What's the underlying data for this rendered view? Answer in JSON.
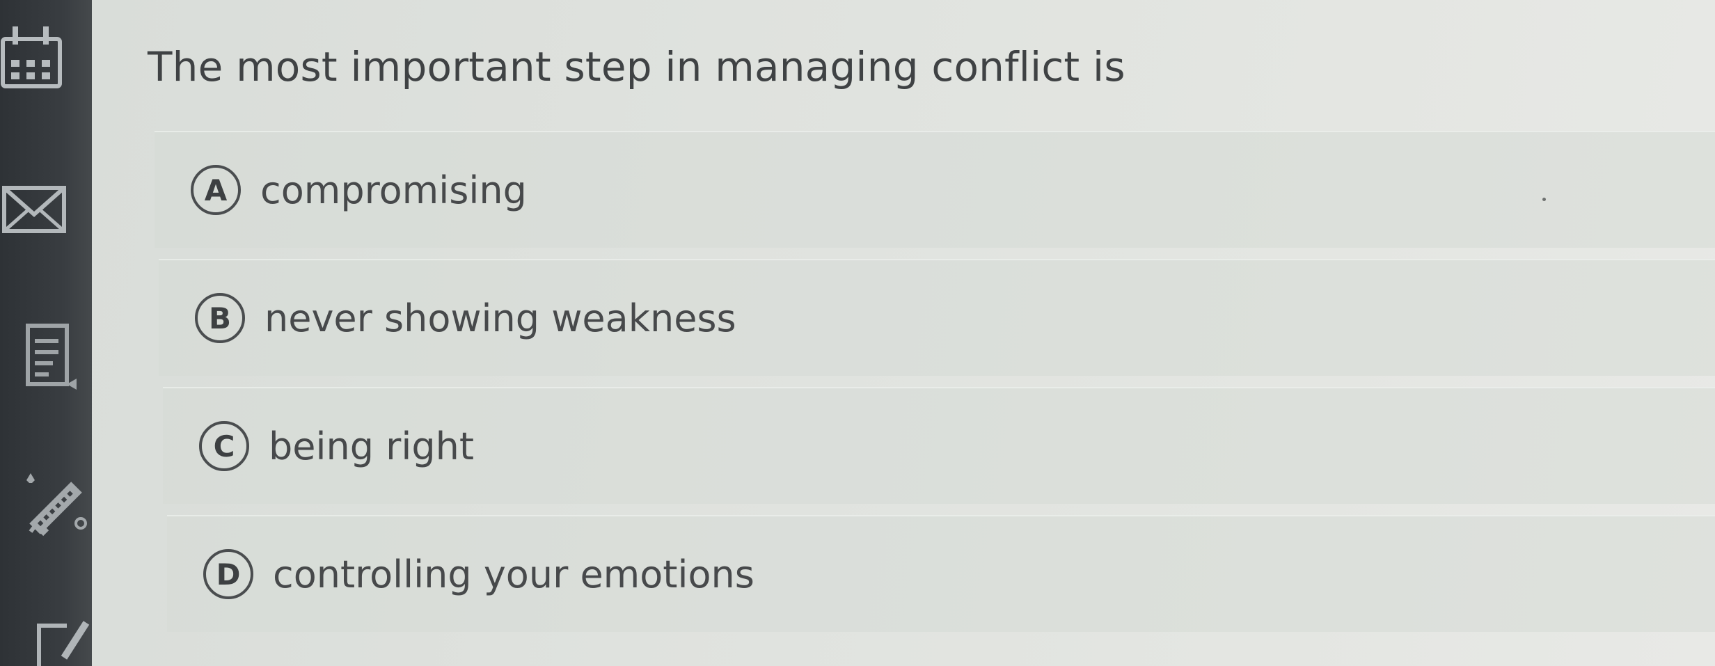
{
  "question": {
    "text": "The most important step in managing conflict is"
  },
  "options": [
    {
      "letter": "A",
      "text": "compromising"
    },
    {
      "letter": "B",
      "text": "never showing weakness"
    },
    {
      "letter": "C",
      "text": "being right"
    },
    {
      "letter": "D",
      "text": "controlling your emotions"
    }
  ],
  "sidebar": {
    "icons": [
      "calendar-icon",
      "mail-icon",
      "notes-icon",
      "pencil-icon",
      "edit-icon"
    ]
  }
}
